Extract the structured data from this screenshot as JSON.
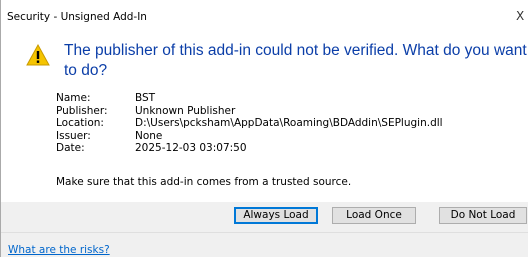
{
  "window": {
    "title": "Security - Unsigned Add-In",
    "close_glyph": "X"
  },
  "heading": "The publisher of this add-in could not be verified. What do you want to do?",
  "icon": "warning-icon",
  "details": [
    {
      "label": "Name:",
      "value": "BST"
    },
    {
      "label": "Publisher:",
      "value": "Unknown Publisher"
    },
    {
      "label": "Location:",
      "value": "D:\\Users\\pcksham\\AppData\\Roaming\\BDAddin\\SEPlugin.dll"
    },
    {
      "label": "Issuer:",
      "value": "None"
    },
    {
      "label": "Date:",
      "value": "2025-12-03 03:07:50"
    }
  ],
  "note": "Make sure that this add-in comes from a trusted source.",
  "buttons": {
    "always_load": "Always Load",
    "load_once": "Load Once",
    "do_not_load": "Do Not Load"
  },
  "footer": {
    "risk_link": "What are the risks?"
  },
  "colors": {
    "heading": "#0b3ea8",
    "link": "#0066cc",
    "warning_fill": "#f5c400",
    "button_bar": "#f0f0f0"
  }
}
